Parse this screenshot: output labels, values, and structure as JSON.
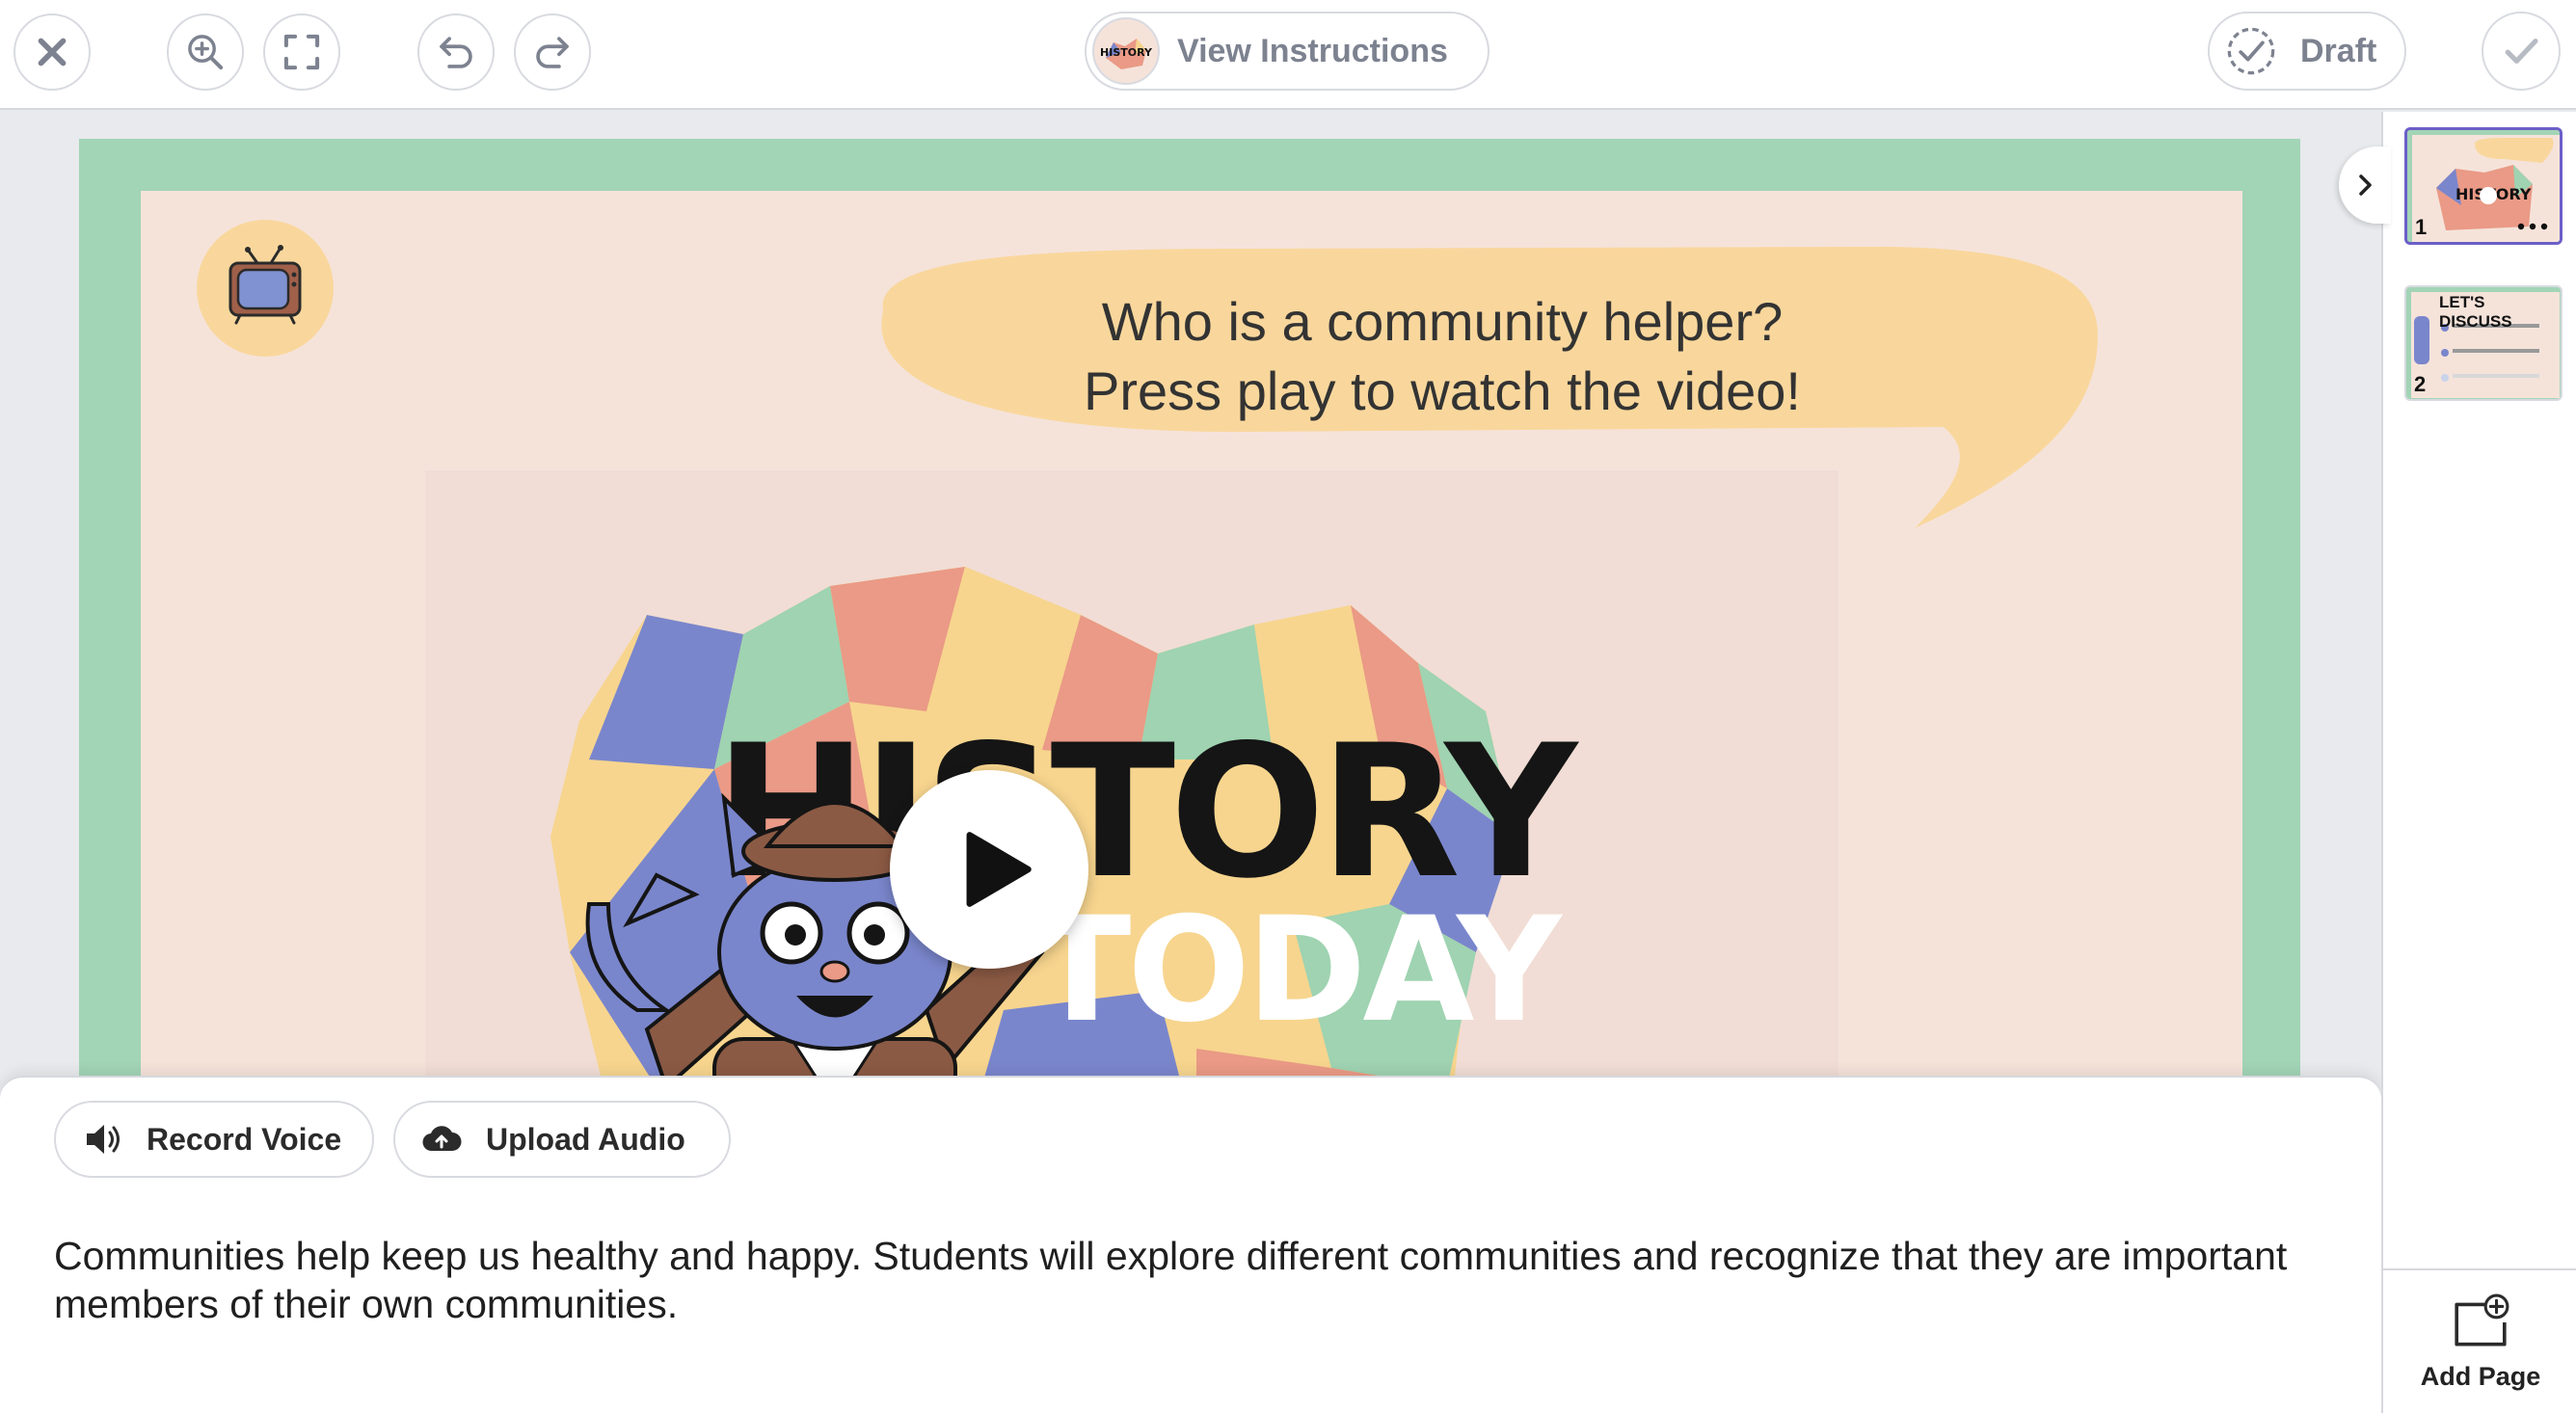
{
  "toolbar": {
    "view_instructions_label": "View Instructions",
    "draft_label": "Draft"
  },
  "slide": {
    "question_line1": "Who is a community helper?",
    "question_line2": "Press play to watch the video!",
    "video_title_line1": "HISTORY",
    "video_title_line2": "TODAY"
  },
  "audio": {
    "record_label": "Record Voice",
    "upload_label": "Upload Audio"
  },
  "description": "Communities help keep us healthy and happy. Students will explore different communities and recognize that they are important members of their own communities.",
  "pages": [
    {
      "number": "1"
    },
    {
      "number": "2",
      "heading": "LET'S DISCUSS"
    }
  ],
  "add_page_label": "Add Page",
  "colors": {
    "slide_border": "#a2d4b6",
    "slide_bg": "#f5e3da",
    "bubble": "#f9d79c",
    "accent_purple": "#6c5fc7"
  }
}
